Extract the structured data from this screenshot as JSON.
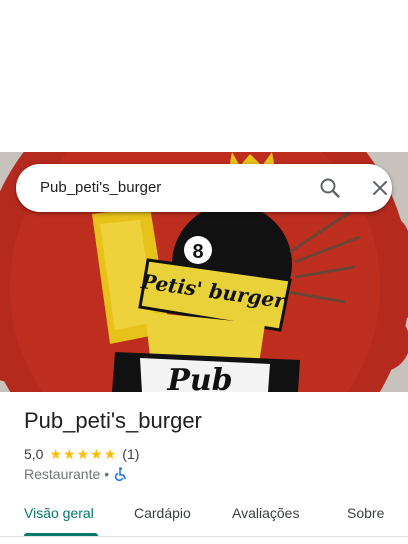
{
  "search": {
    "query": "Pub_peti's_burger",
    "search_icon": "search-icon",
    "close_icon": "close-icon"
  },
  "hero": {
    "image": "restaurant-mural-photo",
    "ball_number": "8",
    "banner_text": "Petis' burger",
    "pub_text": "Pub"
  },
  "place": {
    "name": "Pub_peti's_burger",
    "rating": "5,0",
    "stars": 5,
    "review_count": "(1)",
    "category": "Restaurante",
    "separator": "•",
    "accessibility_icon": "wheelchair-icon"
  },
  "tabs": [
    {
      "label": "Visão geral",
      "active": true
    },
    {
      "label": "Cardápio",
      "active": false
    },
    {
      "label": "Avaliações",
      "active": false
    },
    {
      "label": "Sobre",
      "active": false
    }
  ],
  "colors": {
    "accent": "#00796b",
    "star": "#fbbc04",
    "text_primary": "#202124",
    "text_secondary": "#70757a"
  }
}
